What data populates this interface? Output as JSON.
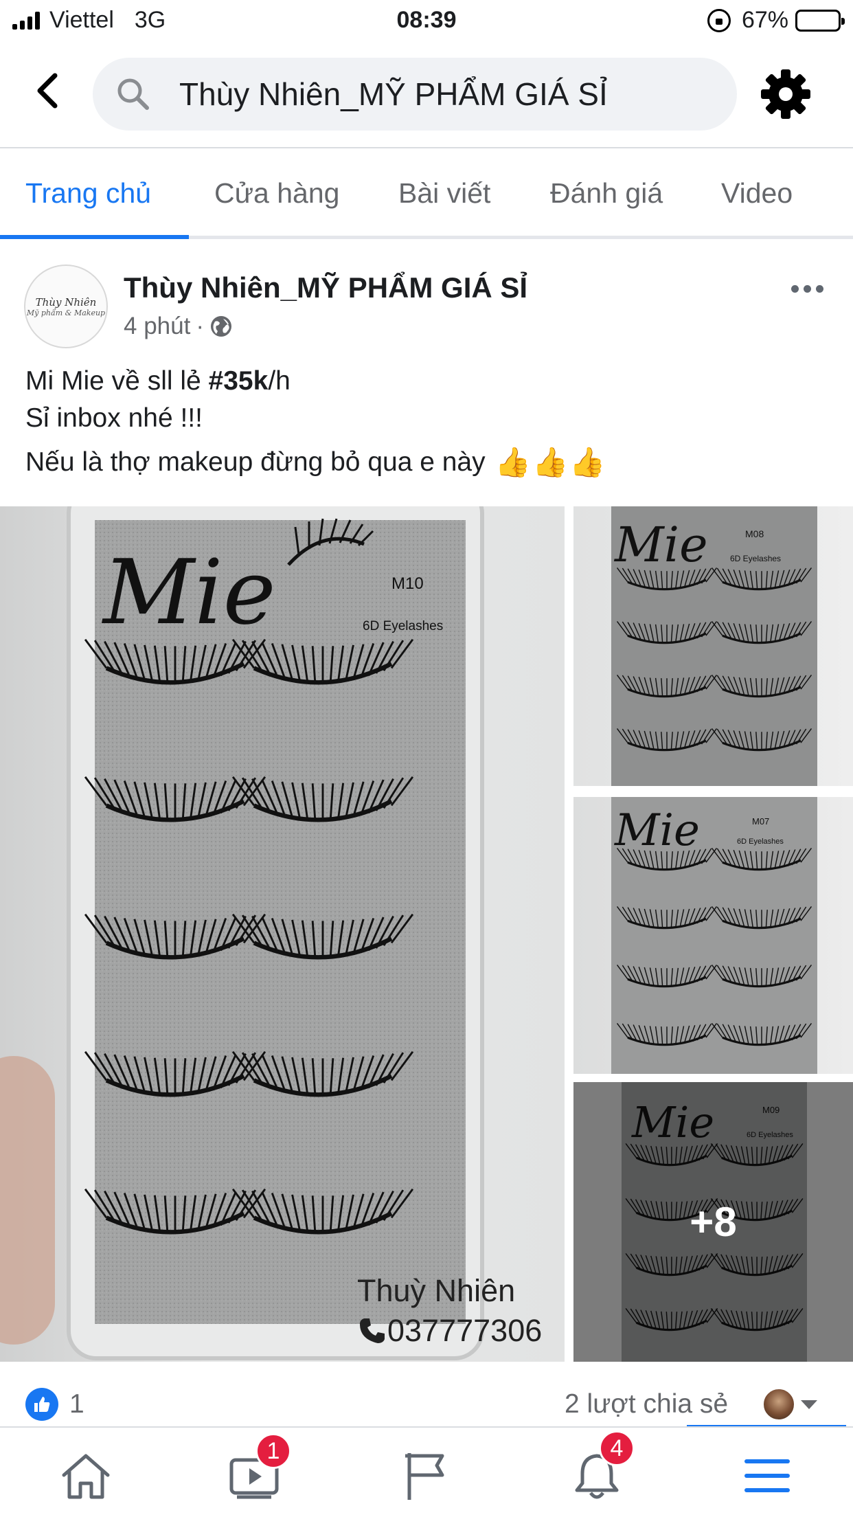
{
  "status_bar": {
    "carrier": "Viettel",
    "network": "3G",
    "time": "08:39",
    "battery": "67%",
    "battery_level": 0.67
  },
  "header": {
    "search_text": "Thùy Nhiên_MỸ PHẨM GIÁ SỈ",
    "icons": [
      "back-arrow-icon",
      "search-icon",
      "gear-icon"
    ]
  },
  "tabs": {
    "items": [
      {
        "label": "Trang chủ",
        "active": true
      },
      {
        "label": "Cửa hàng",
        "active": false
      },
      {
        "label": "Bài viết",
        "active": false
      },
      {
        "label": "Đánh giá",
        "active": false
      },
      {
        "label": "Video",
        "active": false
      }
    ],
    "accent_color": "#1877f2"
  },
  "post": {
    "page_name": "Thùy Nhiên_MỸ PHẨM GIÁ SỈ",
    "time": "4 phút",
    "separator": "·",
    "privacy_icon": "globe-icon",
    "avatar": {
      "line1": "Thùy Nhiên",
      "line2": "Mỹ phẩm & Makeup"
    },
    "text": {
      "line1_prefix": "Mi Mie về sll lẻ ",
      "line1_hashtag": "#35k",
      "line1_suffix": "/h",
      "line2": "Sỉ inbox nhé !!!",
      "line3": "Nếu là thợ makeup đừng bỏ qua e này",
      "emoji": [
        "👍",
        "👍",
        "👍"
      ]
    },
    "photos": {
      "main": {
        "brand": "Mie",
        "model": "M10",
        "subtitle": "6D Eyelashes"
      },
      "thumbs": [
        {
          "brand": "Mie",
          "model": "M08",
          "subtitle": "6D Eyelashes"
        },
        {
          "brand": "Mie",
          "model": "M07",
          "subtitle": "6D Eyelashes"
        },
        {
          "brand": "Mie",
          "model": "M09",
          "subtitle": "6D Eyelashes",
          "overlay": "+8"
        }
      ],
      "watermark_name": "Thuỳ Nhiên",
      "watermark_phone": "037777306"
    },
    "reactions_count": "1",
    "shares": "2 lượt chia sẻ"
  },
  "bottom_nav": {
    "items": [
      {
        "icon": "home-icon",
        "badge": ""
      },
      {
        "icon": "video-icon",
        "badge": "1"
      },
      {
        "icon": "flag-icon",
        "badge": ""
      },
      {
        "icon": "bell-icon",
        "badge": "4"
      },
      {
        "icon": "menu-icon",
        "badge": ""
      }
    ],
    "badge_color": "#e41e3f"
  }
}
